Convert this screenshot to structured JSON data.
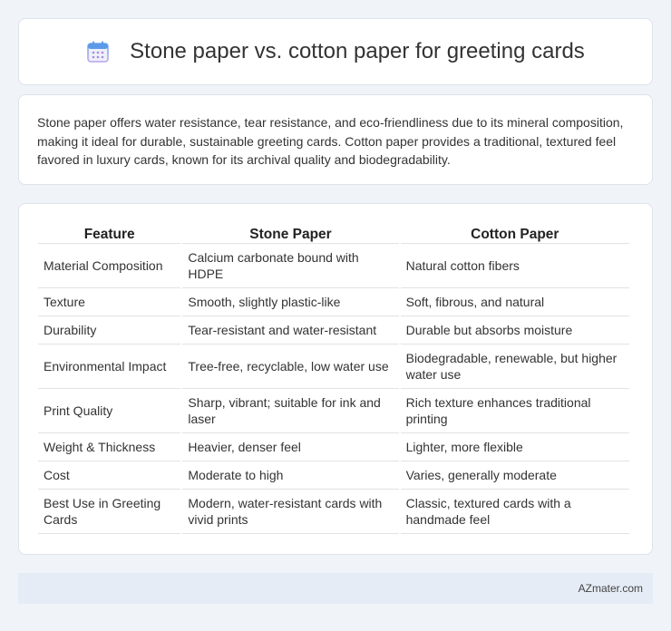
{
  "header": {
    "title": "Stone paper vs. cotton paper for greeting cards",
    "icon": "calendar-icon"
  },
  "summary": {
    "text": "Stone paper offers water resistance, tear resistance, and eco-friendliness due to its mineral composition, making it ideal for durable, sustainable greeting cards. Cotton paper provides a traditional, textured feel favored in luxury cards, known for its archival quality and biodegradability."
  },
  "table": {
    "headers": [
      "Feature",
      "Stone Paper",
      "Cotton Paper"
    ],
    "rows": [
      [
        "Material Composition",
        "Calcium carbonate bound with HDPE",
        "Natural cotton fibers"
      ],
      [
        "Texture",
        "Smooth, slightly plastic-like",
        "Soft, fibrous, and natural"
      ],
      [
        "Durability",
        "Tear-resistant and water-resistant",
        "Durable but absorbs moisture"
      ],
      [
        "Environmental Impact",
        "Tree-free, recyclable, low water use",
        "Biodegradable, renewable, but higher water use"
      ],
      [
        "Print Quality",
        "Sharp, vibrant; suitable for ink and laser",
        "Rich texture enhances traditional printing"
      ],
      [
        "Weight & Thickness",
        "Heavier, denser feel",
        "Lighter, more flexible"
      ],
      [
        "Cost",
        "Moderate to high",
        "Varies, generally moderate"
      ],
      [
        "Best Use in Greeting Cards",
        "Modern, water-resistant cards with vivid prints",
        "Classic, textured cards with a handmade feel"
      ]
    ]
  },
  "footer": {
    "brand": "AZmater.com"
  },
  "colors": {
    "page_bg": "#f0f3f8",
    "card_bg": "#ffffff",
    "footer_bg": "#e6ecf6",
    "icon_blue": "#4a90e2",
    "icon_purple": "#a88be0"
  }
}
